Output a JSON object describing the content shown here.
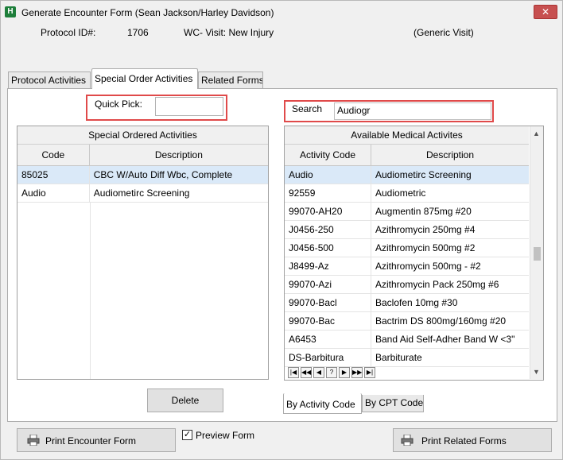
{
  "window": {
    "title": "Generate Encounter Form (Sean Jackson/Harley Davidson)",
    "close_glyph": "✕",
    "icon_glyph": "H"
  },
  "header": {
    "protocol_label": "Protocol ID#:",
    "protocol_id": "1706",
    "visit_type": "WC- Visit: New Injury",
    "visit_kind": "(Generic Visit)"
  },
  "tabs": [
    {
      "label": "Protocol Activities"
    },
    {
      "label": "Special Order Activities"
    },
    {
      "label": "Related Forms"
    }
  ],
  "quick_pick": {
    "label": "Quick Pick:",
    "value": ""
  },
  "search": {
    "label": "Search",
    "value": "Audiogr"
  },
  "special_ordered": {
    "caption": "Special Ordered Activities",
    "columns": [
      "Code",
      "Description"
    ],
    "rows": [
      {
        "code": "85025",
        "description": "CBC W/Auto Diff Wbc, Complete"
      },
      {
        "code": "Audio",
        "description": "Audiometirc Screening"
      }
    ]
  },
  "available": {
    "caption": "Available Medical Activites",
    "columns": [
      "Activity Code",
      "Description"
    ],
    "rows": [
      {
        "code": "Audio",
        "description": "Audiometirc Screening"
      },
      {
        "code": "92559",
        "description": "Audiometric"
      },
      {
        "code": "99070-AH20",
        "description": "Augmentin 875mg #20"
      },
      {
        "code": "J0456-250",
        "description": "Azithromycin 250mg #4"
      },
      {
        "code": "J0456-500",
        "description": "Azithromycin 500mg #2"
      },
      {
        "code": "J8499-Az",
        "description": "Azithromycin 500mg - #2"
      },
      {
        "code": "99070-Azi",
        "description": "Azithromycin Pack 250mg #6"
      },
      {
        "code": "99070-Bacl",
        "description": "Baclofen 10mg #30"
      },
      {
        "code": "99070-Bac",
        "description": "Bactrim DS 800mg/160mg #20"
      },
      {
        "code": "A6453",
        "description": "Band Aid Self-Adher Band W <3\""
      },
      {
        "code": "DS-Barbitura",
        "description": "Barbiturate"
      }
    ],
    "nav_glyphs": [
      "|◀",
      "◀◀",
      "◀",
      "?",
      "▶",
      "▶▶",
      "▶|"
    ]
  },
  "bottom_tabs": [
    {
      "label": "By Activity Code"
    },
    {
      "label": "By CPT Code"
    }
  ],
  "buttons": {
    "delete": "Delete",
    "print_encounter": "Print Encounter Form",
    "preview_form": "Preview Form",
    "print_related": "Print Related Forms"
  },
  "preview_checked": true,
  "colors": {
    "highlight_box": "#e04a4a",
    "selected_row": "#dae9f8",
    "close_button": "#c75050"
  }
}
